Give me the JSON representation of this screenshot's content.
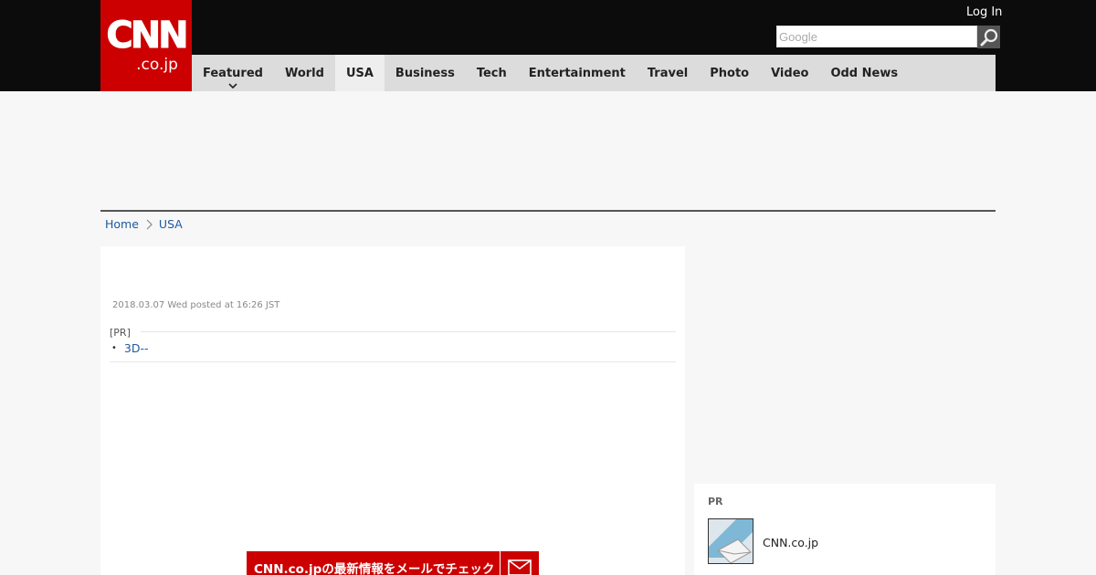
{
  "header": {
    "logo_main": "CNN",
    "logo_sub": ".co.jp",
    "login_label": "Log In",
    "search_placeholder": "Google"
  },
  "nav": {
    "items": [
      {
        "label": "Featured",
        "has_dropdown": true
      },
      {
        "label": "World"
      },
      {
        "label": "USA",
        "active": true
      },
      {
        "label": "Business"
      },
      {
        "label": "Tech"
      },
      {
        "label": "Entertainment"
      },
      {
        "label": "Travel"
      },
      {
        "label": "Photo"
      },
      {
        "label": "Video"
      },
      {
        "label": "Odd News"
      }
    ]
  },
  "breadcrumb": {
    "home": "Home",
    "current": "USA"
  },
  "article": {
    "posted": "2018.03.07 Wed posted at 16:26 JST",
    "pr_label": "[PR]",
    "pr_link": "3D--"
  },
  "mail_banner": {
    "text": "CNN.co.jpの最新情報をメールでチェック",
    "icon": "envelope-icon"
  },
  "sidebar": {
    "pr_label": "PR",
    "item_text": "CNN.co.jp",
    "item_icon": "email-thumbnail"
  },
  "colors": {
    "brand_red": "#cc0000",
    "topbar": "#0c0c0c",
    "nav_bg": "#dcdcdc",
    "link": "#1e5aa0"
  }
}
